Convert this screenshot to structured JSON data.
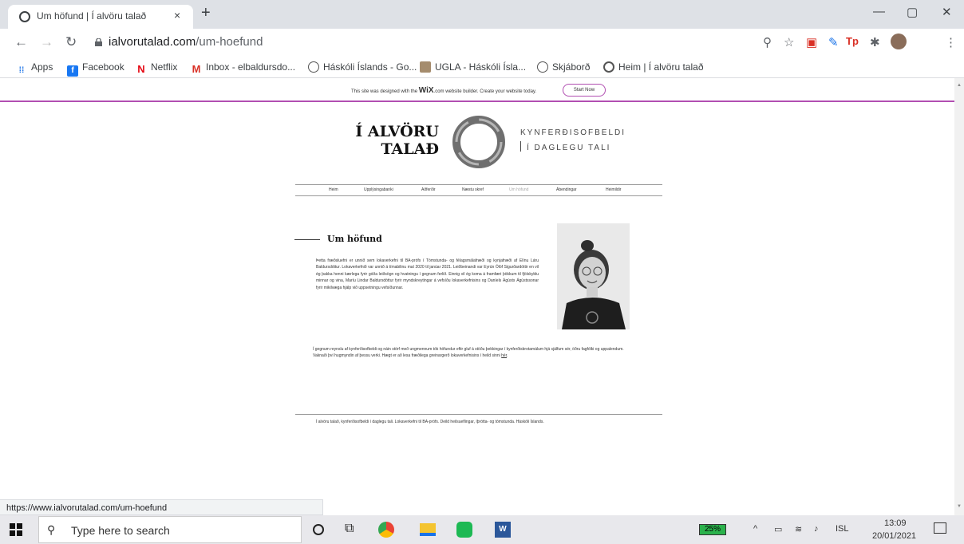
{
  "browser": {
    "tab_title": "Um höfund | Í alvöru talað",
    "tab_close": "×",
    "new_tab": "+",
    "url_domain": "ialvorutalad.com",
    "url_path": "/um-hoefund",
    "window_controls": [
      "—",
      "▢",
      "✕"
    ],
    "bookmarks": [
      {
        "label": "Apps",
        "icon": "apps-grid-icon"
      },
      {
        "label": "Facebook",
        "icon": "facebook-icon"
      },
      {
        "label": "Netflix",
        "icon": "netflix-icon"
      },
      {
        "label": "Inbox - elbaldursdo...",
        "icon": "gmail-icon"
      },
      {
        "label": "Háskóli Íslands - Go...",
        "icon": "globe-icon"
      },
      {
        "label": "UGLA - Háskóli Ísla...",
        "icon": "ugla-icon"
      },
      {
        "label": "Skjáborð",
        "icon": "skjabord-icon"
      },
      {
        "label": "Heim | Í alvöru talað",
        "icon": "site-icon"
      }
    ],
    "status_url": "https://www.ialvorutalad.com/um-hoefund"
  },
  "page": {
    "wix_banner": {
      "text_before": "This site was designed with the ",
      "brand": "WiX",
      "text_after": ".com website builder. Create your website today.",
      "button": "Start Now"
    },
    "logo_line1": "Í ALVÖRU",
    "logo_line2": "TALAÐ",
    "tagline_line1": "KYNFERÐISOFBELDI",
    "tagline_line2": "Í DAGLEGU TALI",
    "nav": [
      "Heim",
      "Upplýsingabanki",
      "Aðferðir",
      "Næstu skref",
      "Um höfund",
      "Ábendingar",
      "Heimildir"
    ],
    "section_title": "Um höfund",
    "para1": "Þetta fræðsluefni er unnið sem lokaverkefni til BA-prófs í Tómstunda- og félagsmálafræði og kynjafræði af Elínu Láru Baldursdóttur. Lokaverkefnið var unnið á tímabilinu maí 2020 til janúar 2021. Leiðbeinandi var Eyrún Ólöf Sigurðardóttir en vil ég þakka henni kærlega fyrir góða leiðsögn og hvatningu í gegnum ferlið. Einnig vil ég koma á framfæri þökkum til fjölskyldu minnar og vina, Maríu Lindar Baldursdóttur fyrir myndskreytingar á vefsíðu lokaverkefnisins og Daníels Ágústs Ágústssonar fyrir mikilvæga hjálp við uppsetningu vefsíðunnar.",
    "para2": "Í gegnum reynslu af kynferðisofbeldi og náin störf með ungmennum tók höfundur eftir gluf á stöðu þekkingar í kynferðisbrotamálum hjá sjálfum sér, öðru fagfólki og uppalendum. Vaknaði því hugmyndin af þessu verki. Hægt er að lesa fræðilega greinargerð lokaverkefnisins í heild sinni ",
    "para2_link": "hér",
    "footer": "Í alvöru talað, kynferðisofbeldi í daglegu tali. Lokaverkefni til BA-prófs. Deild heilsueflingar, íþrótta- og tómstunda. Háskóli Íslands."
  },
  "taskbar": {
    "search_placeholder": "Type here to search",
    "battery": "25%",
    "language": "ISL",
    "time": "13:09",
    "date": "20/01/2021"
  },
  "colors": {
    "wix_accent": "#b14eb1",
    "battery": "#2bb24c"
  }
}
